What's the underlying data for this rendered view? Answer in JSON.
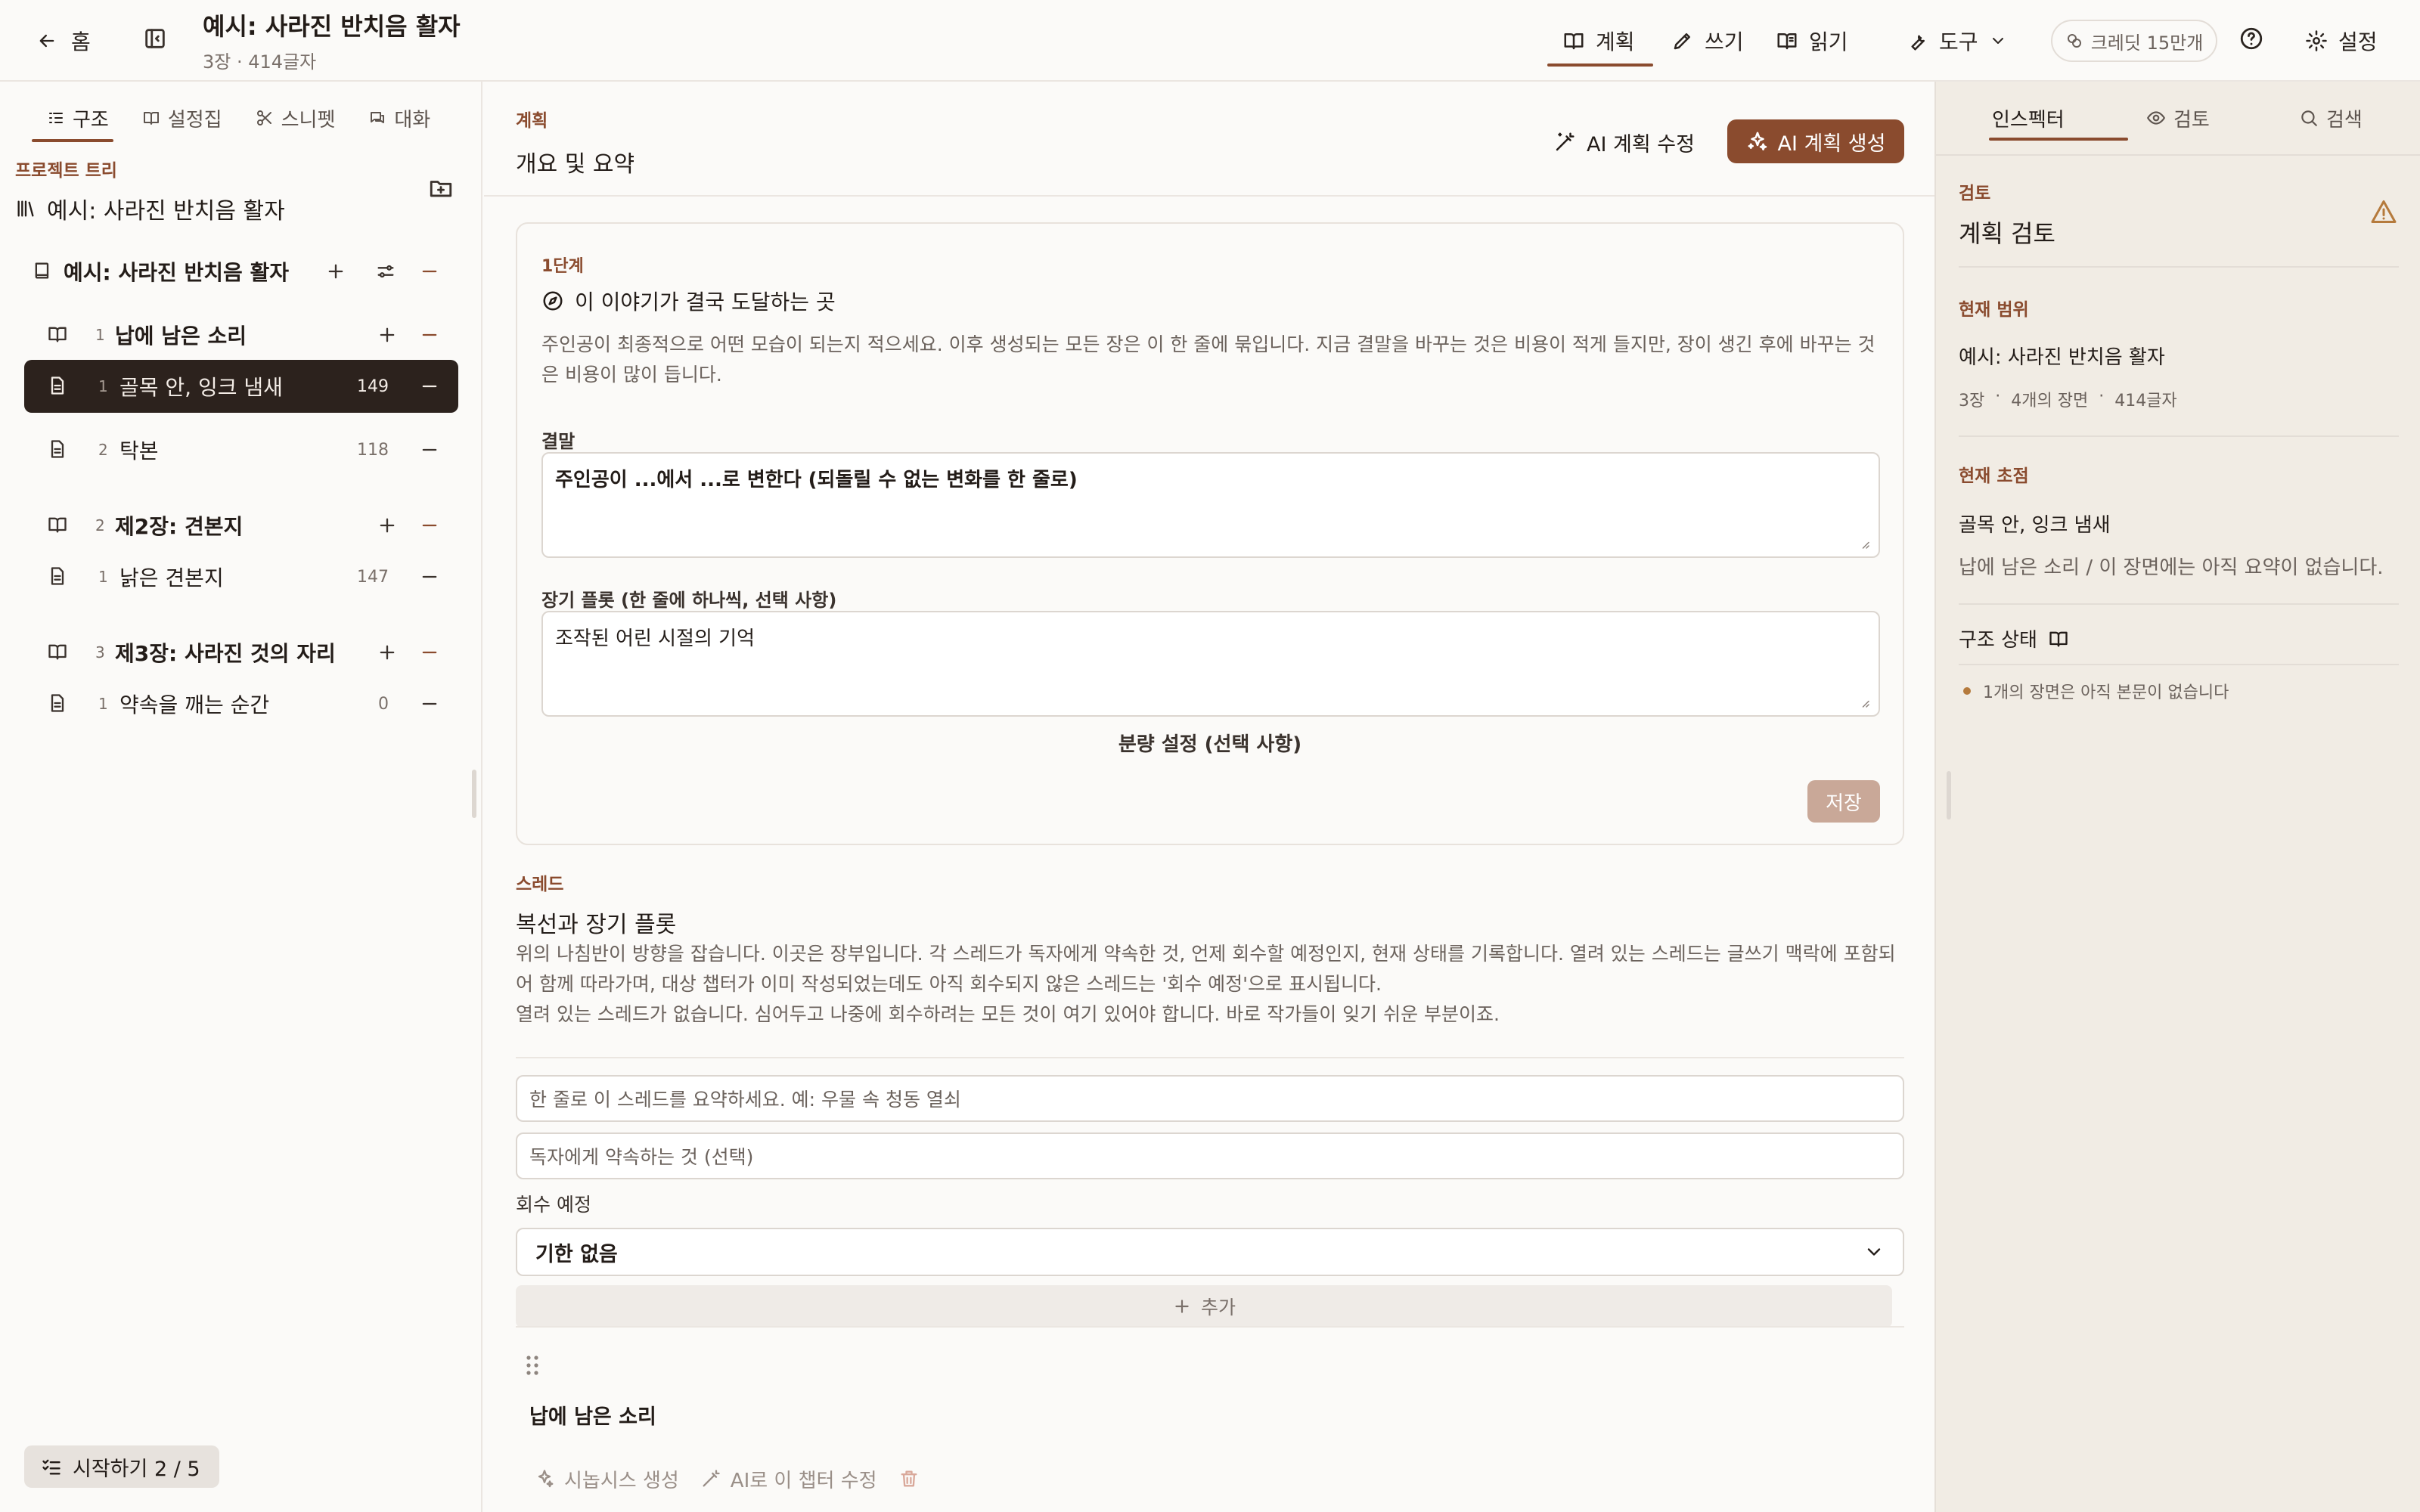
{
  "topbar": {
    "home_label": "홈",
    "title": "예시: 사라진 반치음 활자",
    "subtitle": "3장 · 414글자",
    "nav": {
      "plan": "계획",
      "write": "쓰기",
      "read": "읽기",
      "tools": "도구"
    },
    "credit": "크레딧 15만개",
    "settings": "설정"
  },
  "left": {
    "tabs": [
      "구조",
      "설정집",
      "스니펫",
      "대화"
    ],
    "section_label": "프로젝트 트리",
    "project_name": "예시: 사라진 반치음 활자",
    "tree": [
      {
        "type": "book",
        "label": "예시: 사라진 반치음 활자"
      },
      {
        "type": "chapter",
        "num": "1",
        "label": "납에 남은 소리"
      },
      {
        "type": "scene",
        "num": "1",
        "label": "골목 안, 잉크 냄새",
        "count": "149",
        "selected": true
      },
      {
        "type": "scene",
        "num": "2",
        "label": "탁본",
        "count": "118"
      },
      {
        "type": "chapter",
        "num": "2",
        "label": "제2장: 견본지"
      },
      {
        "type": "scene",
        "num": "1",
        "label": "낡은 견본지",
        "count": "147"
      },
      {
        "type": "chapter",
        "num": "3",
        "label": "제3장: 사라진 것의 자리"
      },
      {
        "type": "scene",
        "num": "1",
        "label": "약속을 깨는 순간",
        "count": "0"
      }
    ],
    "start_button": "시작하기 2 / 5"
  },
  "main": {
    "section_label": "계획",
    "heading": "개요 및 요약",
    "ai_edit": "AI 계획 수정",
    "ai_generate": "AI 계획 생성",
    "step": {
      "label": "1단계",
      "question": "이 이야기가 결국 도달하는 곳",
      "description": "주인공이 최종적으로 어떤 모습이 되는지 적으세요. 이후 생성되는 모든 장은 이 한 줄에 묶입니다. 지금 결말을 바꾸는 것은 비용이 적게 들지만, 장이 생긴 후에 바꾸는 것은 비용이 많이 듭니다.",
      "ending_label": "결말",
      "ending_value": "주인공이 ...에서 ...로 변한다 (되돌릴 수 없는 변화를 한 줄로)",
      "plot_label": "장기 플롯 (한 줄에 하나씩, 선택 사항)",
      "plot_value": "조작된 어린 시절의 기억",
      "volume": "분량 설정 (선택 사항)",
      "save": "저장"
    },
    "thread": {
      "label": "스레드",
      "title": "복선과 장기 플롯",
      "description": "위의 나침반이 방향을 잡습니다. 이곳은 장부입니다. 각 스레드가 독자에게 약속한 것, 언제 회수할 예정인지, 현재 상태를 기록합니다. 열려 있는 스레드는 글쓰기 맥락에 포함되어 함께 따라가며, 대상 챕터가 이미 작성되었는데도 아직 회수되지 않은 스레드는 '회수 예정'으로 표시됩니다.",
      "empty": "열려 있는 스레드가 없습니다. 심어두고 나중에 회수하려는 모든 것이 여기 있어야 합니다. 바로 작가들이 잊기 쉬운 부분이죠.",
      "summary_placeholder": "한 줄로 이 스레드를 요약하세요. 예: 우물 속 청동 열쇠",
      "promise_placeholder": "독자에게 약속하는 것 (선택)",
      "due_label": "회수 예정",
      "due_value": "기한 없음",
      "add": "추가"
    },
    "chapter": {
      "title": "납에 남은 소리",
      "synopsis": "시놉시스 생성",
      "ai_edit": "AI로 이 챕터 수정"
    }
  },
  "right": {
    "tabs": [
      "인스펙터",
      "검토",
      "검색"
    ],
    "review_label": "검토",
    "review_title": "계획 검토",
    "scope_label": "현재 범위",
    "scope_name": "예시: 사라진 반치음 활자",
    "scope_meta": [
      "3장",
      "·",
      "4개의 장면",
      "·",
      "414글자"
    ],
    "focus_label": "현재 초점",
    "focus_name": "골목 안, 잉크 냄새",
    "focus_desc": "납에 남은 소리 / 이 장면에는 아직 요약이 없습니다.",
    "struct_label": "구조 상태",
    "struct_item": "1개의 장면은 아직 본문이 없습니다"
  },
  "colors": {
    "accent": "#8a4b2e",
    "selected_bg": "#2c221d",
    "warning": "#b57a3c"
  }
}
